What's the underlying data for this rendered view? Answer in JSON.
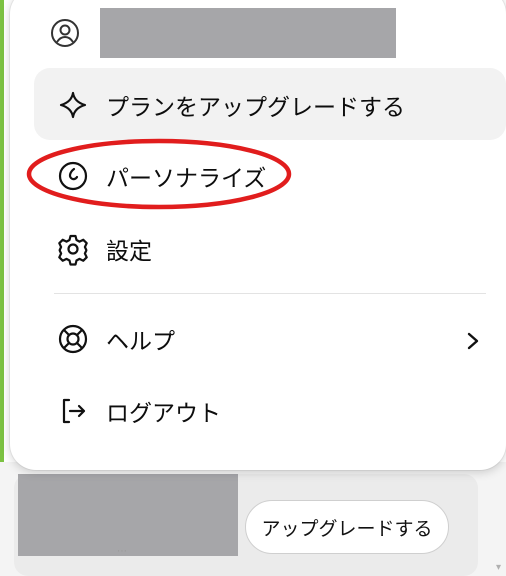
{
  "menu": {
    "account": {
      "name": "",
      "icon": "user-circle-icon"
    },
    "items": [
      {
        "label": "プランをアップグレードする",
        "icon": "sparkle-icon"
      },
      {
        "label": "パーソナライズ",
        "icon": "personalize-icon"
      },
      {
        "label": "設定",
        "icon": "gear-icon"
      },
      {
        "label": "ヘルプ",
        "icon": "lifebuoy-icon"
      },
      {
        "label": "ログアウト",
        "icon": "logout-icon"
      }
    ],
    "help_chevron": "chevron-right-icon"
  },
  "footer": {
    "upgrade_button_label": "アップグレードする"
  },
  "colors": {
    "highlight_ring": "#e11d1d",
    "hover_bg": "#f2f2f2",
    "redaction": "#a6a6a9",
    "left_accent": "#7cc242"
  }
}
